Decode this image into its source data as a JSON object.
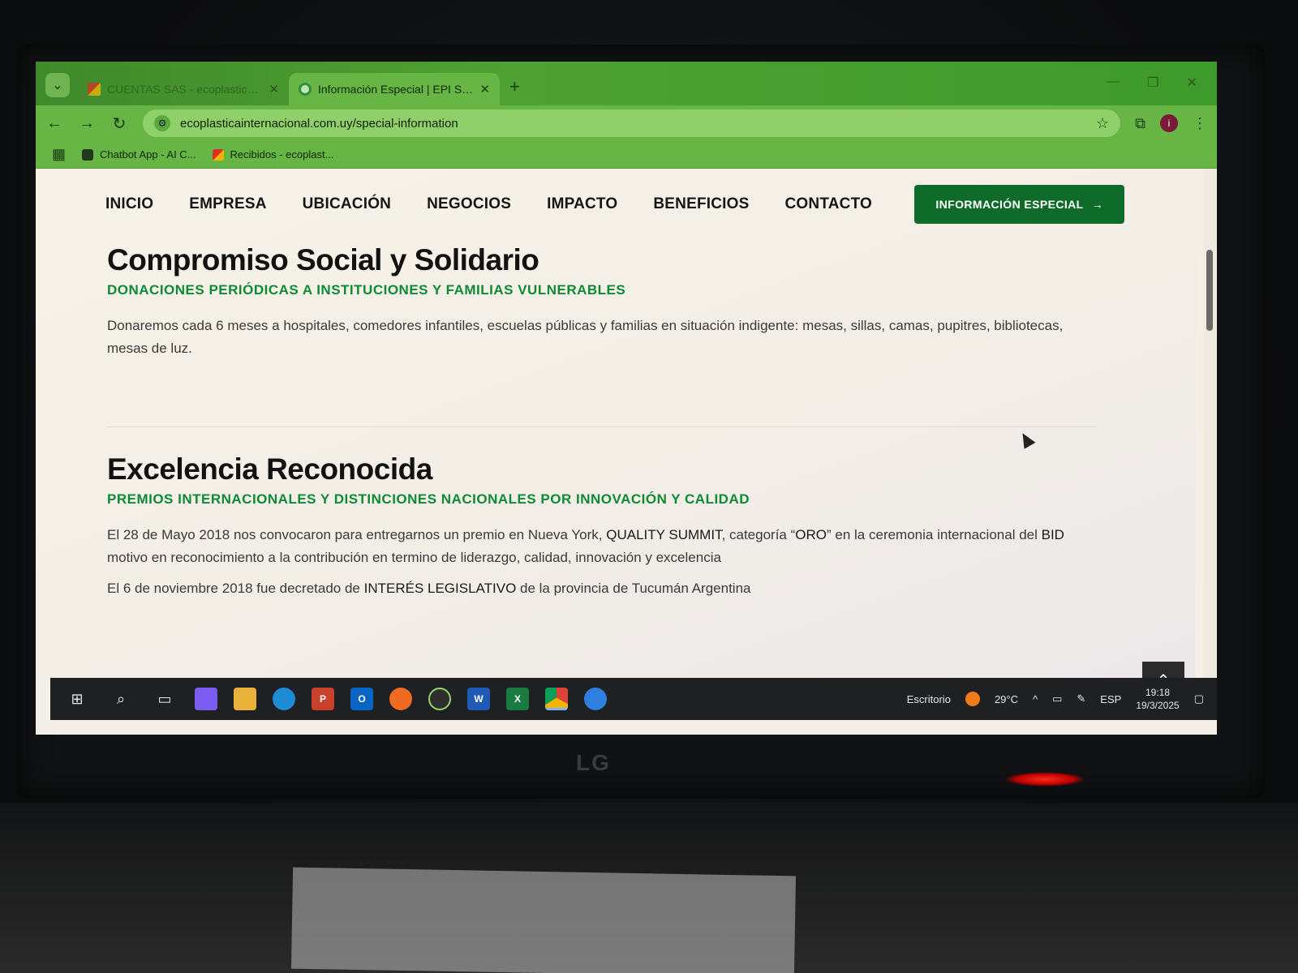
{
  "browser": {
    "tabs": [
      {
        "title": "CUENTAS SAS - ecoplasticaint",
        "active": false
      },
      {
        "title": "Información Especial | EPI S. A.",
        "active": true
      }
    ],
    "url": "ecoplasticainternacional.com.uy/special-information",
    "bookmarks": [
      "Chatbot App - AI C...",
      "Recibidos - ecoplast..."
    ]
  },
  "nav": {
    "items": [
      "INICIO",
      "EMPRESA",
      "UBICACIÓN",
      "NEGOCIOS",
      "IMPACTO",
      "BENEFICIOS",
      "CONTACTO"
    ],
    "cta": "INFORMACIÓN ESPECIAL"
  },
  "sections": [
    {
      "title": "Compromiso Social y Solidario",
      "subtitle": "DONACIONES PERIÓDICAS A INSTITUCIONES Y FAMILIAS VULNERABLES",
      "body": "Donaremos cada 6 meses a hospitales, comedores infantiles, escuelas públicas y familias en situación indigente: mesas, sillas, camas, pupitres, bibliotecas, mesas de luz."
    },
    {
      "title": "Excelencia Reconocida",
      "subtitle": "PREMIOS INTERNACIONALES Y DISTINCIONES NACIONALES POR INNOVACIÓN Y CALIDAD",
      "body_pre": "El 28 de Mayo 2018 nos convocaron para entregarnos un premio en Nueva York, ",
      "body_b1": "QUALITY SUMMIT",
      "body_mid": ", categoría “",
      "body_b2": "ORO",
      "body_mid2": "” en la ceremonia internacional del ",
      "body_b3": "BID",
      "body_post": " motivo en reconocimiento a la contribución en termino de liderazgo, calidad, innovación y excelencia",
      "bullet_pre": "El 6 de noviembre 2018 fue decretado de ",
      "bullet_b": "INTERÉS LEGISLATIVO",
      "bullet_post": " de la provincia de Tucumán Argentina"
    }
  ],
  "taskbar": {
    "desktop_label": "Escritorio",
    "temperature": "29°C",
    "language": "ESP",
    "time": "19:18",
    "date": "19/3/2025"
  },
  "monitor_brand": "LG"
}
